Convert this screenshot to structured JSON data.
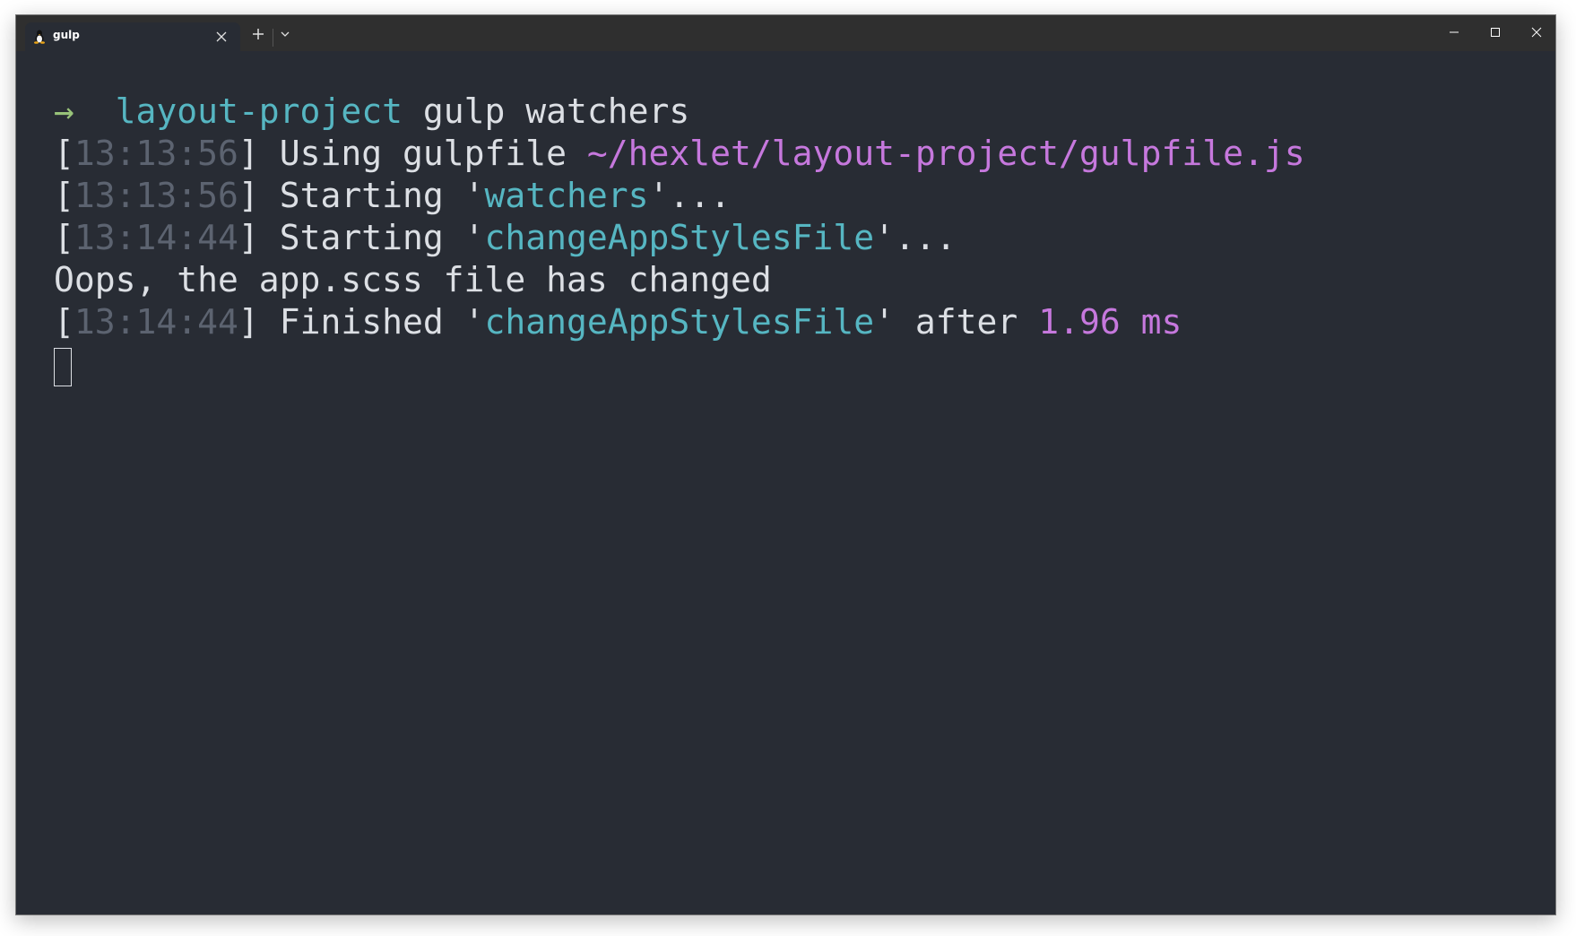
{
  "tab": {
    "icon": "linux-tux-icon",
    "title": "gulp"
  },
  "window_controls": {
    "minimize": "minimize-icon",
    "maximize": "maximize-icon",
    "close": "close-icon"
  },
  "colors": {
    "background": "#282c34",
    "foreground": "#dcdfe4",
    "prompt_arrow": "#98c379",
    "directory": "#56b6c2",
    "path": "#c678dd",
    "timestamp": "#5c6370",
    "task": "#56b6c2",
    "duration": "#c678dd"
  },
  "terminal": {
    "prompt": {
      "arrow": "→",
      "directory": "layout-project",
      "command": "gulp watchers"
    },
    "lines": [
      {
        "open": "[",
        "timestamp": "13:13:56",
        "close": "] ",
        "text": "Using gulpfile ",
        "path": "~/hexlet/layout-project/gulpfile.js"
      },
      {
        "open": "[",
        "timestamp": "13:13:56",
        "close": "] ",
        "text": "Starting '",
        "task": "watchers",
        "suffix": "'..."
      },
      {
        "open": "[",
        "timestamp": "13:14:44",
        "close": "] ",
        "text": "Starting '",
        "task": "changeAppStylesFile",
        "suffix": "'..."
      },
      {
        "plain": "Oops, the app.scss file has changed"
      },
      {
        "open": "[",
        "timestamp": "13:14:44",
        "close": "] ",
        "text": "Finished '",
        "task": "changeAppStylesFile",
        "suffix": "' after ",
        "duration": "1.96 ms"
      }
    ]
  }
}
